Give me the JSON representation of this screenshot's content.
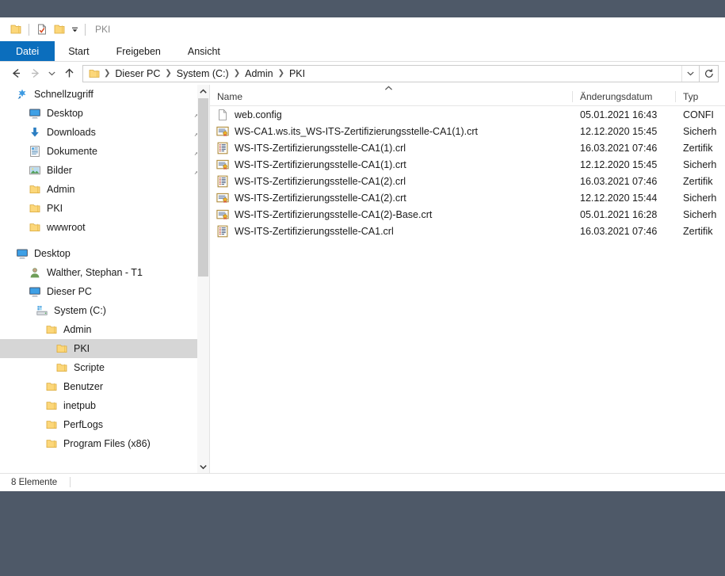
{
  "window": {
    "title": "PKI",
    "quick_access": [
      {
        "name": "folder-icon",
        "label": "Eigenschaften-Ordner"
      },
      {
        "name": "properties-icon",
        "label": "Eigenschaften"
      },
      {
        "name": "new-folder-icon",
        "label": "Neuer Ordner"
      },
      {
        "name": "chevron-down-icon",
        "label": "Symbolleiste für den Schnellzugriff anpassen"
      }
    ]
  },
  "ribbon": {
    "tabs": [
      {
        "label": "Datei",
        "active": true
      },
      {
        "label": "Start",
        "active": false
      },
      {
        "label": "Freigeben",
        "active": false
      },
      {
        "label": "Ansicht",
        "active": false
      }
    ]
  },
  "navbar": {
    "back": "Zurück",
    "forward": "Vorwärts",
    "recent": "Zuletzt besuchte Seiten",
    "up": "Eine Ebene nach oben",
    "breadcrumbs": [
      "Dieser PC",
      "System (C:)",
      "Admin",
      "PKI"
    ],
    "dropdown": "Vorherige Speicherorte",
    "refresh": "PKI aktualisieren"
  },
  "navpane": {
    "groups": [
      {
        "header": {
          "label": "Schnellzugriff",
          "icon": "star-icon",
          "indent": 1
        },
        "items": [
          {
            "label": "Desktop",
            "icon": "desktop-icon",
            "indent": 2,
            "pinned": true,
            "selected": false
          },
          {
            "label": "Downloads",
            "icon": "download-icon",
            "indent": 2,
            "pinned": true,
            "selected": false
          },
          {
            "label": "Dokumente",
            "icon": "documents-icon",
            "indent": 2,
            "pinned": true,
            "selected": false
          },
          {
            "label": "Bilder",
            "icon": "pictures-icon",
            "indent": 2,
            "pinned": true,
            "selected": false
          },
          {
            "label": "Admin",
            "icon": "folder-icon",
            "indent": 2,
            "pinned": false,
            "selected": false
          },
          {
            "label": "PKI",
            "icon": "folder-icon",
            "indent": 2,
            "pinned": false,
            "selected": false
          },
          {
            "label": "wwwroot",
            "icon": "folder-icon",
            "indent": 2,
            "pinned": false,
            "selected": false
          }
        ]
      },
      {
        "header": {
          "label": "Desktop",
          "icon": "desktop-icon",
          "indent": 1
        },
        "items": [
          {
            "label": "Walther, Stephan - T1",
            "icon": "user-icon",
            "indent": 2,
            "pinned": false,
            "selected": false
          },
          {
            "label": "Dieser PC",
            "icon": "thispc-icon",
            "indent": 2,
            "pinned": false,
            "selected": false
          },
          {
            "label": "System (C:)",
            "icon": "drive-icon",
            "indent": 3,
            "pinned": false,
            "selected": false
          },
          {
            "label": "Admin",
            "icon": "folder-icon",
            "indent": 4,
            "pinned": false,
            "selected": false
          },
          {
            "label": "PKI",
            "icon": "folder-icon",
            "indent": 5,
            "pinned": false,
            "selected": true
          },
          {
            "label": "Scripte",
            "icon": "folder-icon",
            "indent": 5,
            "pinned": false,
            "selected": false
          },
          {
            "label": "Benutzer",
            "icon": "folder-icon",
            "indent": 4,
            "pinned": false,
            "selected": false
          },
          {
            "label": "inetpub",
            "icon": "folder-icon",
            "indent": 4,
            "pinned": false,
            "selected": false
          },
          {
            "label": "PerfLogs",
            "icon": "folder-icon",
            "indent": 4,
            "pinned": false,
            "selected": false
          },
          {
            "label": "Program Files (x86)",
            "icon": "folder-icon",
            "indent": 4,
            "pinned": false,
            "selected": false
          }
        ]
      }
    ]
  },
  "filelist": {
    "columns": [
      {
        "key": "name",
        "label": "Name",
        "sorted": "asc"
      },
      {
        "key": "date",
        "label": "Änderungsdatum",
        "sorted": ""
      },
      {
        "key": "typ",
        "label": "Typ",
        "sorted": ""
      }
    ],
    "rows": [
      {
        "name": "web.config",
        "date": "05.01.2021 16:43",
        "typ": "CONFI",
        "icon": "generic-file-icon"
      },
      {
        "name": "WS-CA1.ws.its_WS-ITS-Zertifizierungsstelle-CA1(1).crt",
        "date": "12.12.2020 15:45",
        "typ": "Sicherh",
        "icon": "certificate-icon"
      },
      {
        "name": "WS-ITS-Zertifizierungsstelle-CA1(1).crl",
        "date": "16.03.2021 07:46",
        "typ": "Zertifik",
        "icon": "crl-icon"
      },
      {
        "name": "WS-ITS-Zertifizierungsstelle-CA1(1).crt",
        "date": "12.12.2020 15:45",
        "typ": "Sicherh",
        "icon": "certificate-icon"
      },
      {
        "name": "WS-ITS-Zertifizierungsstelle-CA1(2).crl",
        "date": "16.03.2021 07:46",
        "typ": "Zertifik",
        "icon": "crl-icon"
      },
      {
        "name": "WS-ITS-Zertifizierungsstelle-CA1(2).crt",
        "date": "12.12.2020 15:44",
        "typ": "Sicherh",
        "icon": "certificate-icon"
      },
      {
        "name": "WS-ITS-Zertifizierungsstelle-CA1(2)-Base.crt",
        "date": "05.01.2021 16:28",
        "typ": "Sicherh",
        "icon": "certificate-icon"
      },
      {
        "name": "WS-ITS-Zertifizierungsstelle-CA1.crl",
        "date": "16.03.2021 07:46",
        "typ": "Zertifik",
        "icon": "crl-icon"
      }
    ]
  },
  "statusbar": {
    "count": "8 Elemente"
  },
  "colors": {
    "accent": "#0b6ebd",
    "desktop": "#4e5968",
    "selection": "#d6d6d6",
    "folder": "#fcd77a"
  }
}
